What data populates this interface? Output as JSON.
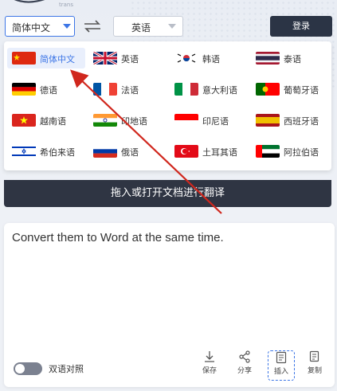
{
  "logo": {
    "text": "biz trans",
    "icon": "swoosh-logo"
  },
  "toolbar": {
    "source_lang": "简体中文",
    "target_lang": "英语",
    "swap_icon": "swap-arrows-icon",
    "login_label": "登录"
  },
  "languages": [
    {
      "label": "简体中文",
      "flag": "cn",
      "selected": true
    },
    {
      "label": "英语",
      "flag": "gb"
    },
    {
      "label": "韩语",
      "flag": "kr"
    },
    {
      "label": "泰语",
      "flag": "th"
    },
    {
      "label": "德语",
      "flag": "de"
    },
    {
      "label": "法语",
      "flag": "fr"
    },
    {
      "label": "意大利语",
      "flag": "it"
    },
    {
      "label": "葡萄牙语",
      "flag": "pt"
    },
    {
      "label": "越南语",
      "flag": "vn"
    },
    {
      "label": "印地语",
      "flag": "in"
    },
    {
      "label": "印尼语",
      "flag": "id"
    },
    {
      "label": "西班牙语",
      "flag": "es"
    },
    {
      "label": "希伯来语",
      "flag": "il"
    },
    {
      "label": "俄语",
      "flag": "ru"
    },
    {
      "label": "土耳其语",
      "flag": "tr"
    },
    {
      "label": "阿拉伯语",
      "flag": "ae"
    }
  ],
  "dropbar": {
    "label": "拖入或打开文档进行翻译"
  },
  "editor": {
    "text": "Convert them to Word at the same time.",
    "bilingual_label": "双语对照",
    "bilingual_on": false
  },
  "actions": [
    {
      "label": "保存",
      "icon": "download-icon"
    },
    {
      "label": "分享",
      "icon": "share-icon"
    },
    {
      "label": "插入",
      "icon": "insert-doc-icon"
    },
    {
      "label": "复制",
      "icon": "copy-icon"
    }
  ],
  "colors": {
    "accent": "#3d76e6",
    "dark": "#2b3445",
    "annotation_arrow": "#d0271d"
  }
}
